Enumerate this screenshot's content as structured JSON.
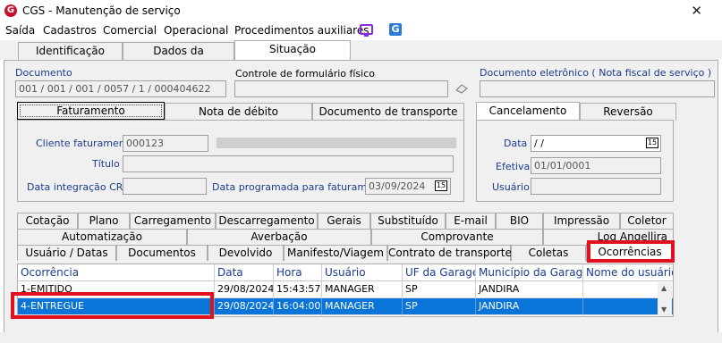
{
  "window": {
    "title": "CGS - Manutenção de serviço",
    "close_glyph": "✕"
  },
  "menu": [
    "Saída",
    "Cadastros",
    "Comercial",
    "Operacional",
    "Procedimentos auxiliares"
  ],
  "main_tabs": [
    "Identificação",
    "Dados da mercadoria",
    "Situação"
  ],
  "documento": {
    "label": "Documento",
    "value": "001 / 001 / 001 / 0057 / 1 / 000404622"
  },
  "controle": {
    "label": "Controle de formulário físico",
    "value": ""
  },
  "doc_eletronico": {
    "label": "Documento eletrônico ( Nota fiscal de serviço )",
    "value": ""
  },
  "faturamento_tabs": [
    "Faturamento",
    "Nota de débito",
    "Documento de transporte"
  ],
  "faturamento": {
    "cliente_label": "Cliente faturamento",
    "cliente_value": "000123",
    "titulo_label": "Título",
    "titulo_value": "",
    "integracao_label": "Data integração CRC",
    "integracao_value": "",
    "programada_label": "Data programada para faturamento",
    "programada_value": "03/09/2024"
  },
  "cancel_tabs": [
    "Cancelamento",
    "Reversão"
  ],
  "cancelamento": {
    "data_label": "Data",
    "data_value": " /  /",
    "efetiva_label": "Efetiva",
    "efetiva_value": "01/01/0001",
    "usuario_label": "Usuário",
    "usuario_value": ""
  },
  "calendar_glyph": "15",
  "bottom_tabs_row1": [
    "Cotação",
    "Plano",
    "Carregamento",
    "Descarregamento",
    "Gerais",
    "Substituído",
    "E-mail",
    "BIO",
    "Impressão",
    "Coletor"
  ],
  "bottom_tabs_row2": [
    "Automatização",
    "Averbação",
    "Comprovante",
    "Log Angellira"
  ],
  "bottom_tabs_row3": [
    "Usuário / Datas",
    "Documentos",
    "Devolvido",
    "Manifesto/Viagem",
    "Contrato de transporte",
    "Coletas",
    "Ocorrências"
  ],
  "grid": {
    "headers": [
      "Ocorrência",
      "Data",
      "Hora",
      "Usuário",
      "UF da Garagem",
      "Município da Garagem",
      "Nome do usuário"
    ],
    "rows": [
      [
        "1-EMITIDO",
        "29/08/2024",
        "15:43:57",
        "MANAGER",
        "SP",
        "JANDIRA",
        ""
      ],
      [
        "4-ENTREGUE",
        "29/08/2024",
        "16:04:00",
        "MANAGER",
        "SP",
        "JANDIRA",
        ""
      ]
    ],
    "selected_row": 1
  },
  "colors": {
    "accent": "#0a74d9",
    "highlight": "#e0101e",
    "label_blue": "#1a3d8f"
  }
}
